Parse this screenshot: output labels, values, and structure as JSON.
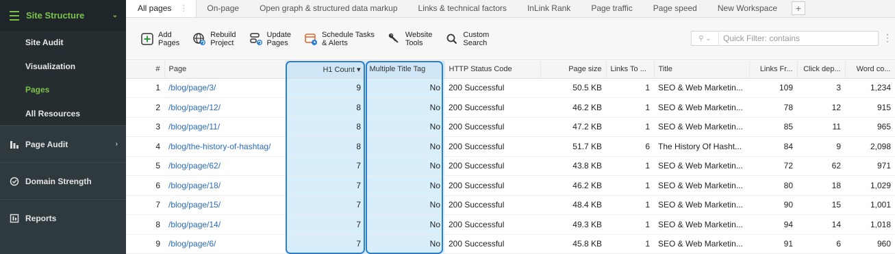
{
  "sidebar": {
    "section_title": "Site Structure",
    "sub_items": [
      {
        "label": "Site Audit",
        "active": false
      },
      {
        "label": "Visualization",
        "active": false
      },
      {
        "label": "Pages",
        "active": true
      },
      {
        "label": "All Resources",
        "active": false
      }
    ],
    "main_items": [
      {
        "label": "Page Audit",
        "icon": "page-audit-icon"
      },
      {
        "label": "Domain Strength",
        "icon": "domain-strength-icon"
      },
      {
        "label": "Reports",
        "icon": "reports-icon"
      }
    ]
  },
  "tabs": [
    "All pages",
    "On-page",
    "Open graph & structured data markup",
    "Links & technical factors",
    "InLink Rank",
    "Page traffic",
    "Page speed",
    "New Workspace"
  ],
  "toolbar": {
    "add_l1": "Add",
    "add_l2": "Pages",
    "rebuild_l1": "Rebuild",
    "rebuild_l2": "Project",
    "update_l1": "Update",
    "update_l2": "Pages",
    "schedule_l1": "Schedule Tasks",
    "schedule_l2": "& Alerts",
    "website_l1": "Website",
    "website_l2": "Tools",
    "custom_l1": "Custom",
    "custom_l2": "Search"
  },
  "filter": {
    "placeholder": "Quick Filter: contains"
  },
  "table": {
    "headers": [
      "#",
      "Page",
      "H1 Count ▾",
      "Multiple Title Tag",
      "HTTP Status Code",
      "Page size",
      "Links To ...",
      "Title",
      "Links Fr...",
      "Click dep...",
      "Word co..."
    ],
    "rows": [
      [
        "1",
        "/blog/page/3/",
        "9",
        "No",
        "200 Successful",
        "50.5 KB",
        "1",
        "SEO & Web Marketin...",
        "109",
        "3",
        "1,234"
      ],
      [
        "2",
        "/blog/page/12/",
        "8",
        "No",
        "200 Successful",
        "46.2 KB",
        "1",
        "SEO & Web Marketin...",
        "78",
        "12",
        "915"
      ],
      [
        "3",
        "/blog/page/11/",
        "8",
        "No",
        "200 Successful",
        "47.2 KB",
        "1",
        "SEO & Web Marketin...",
        "85",
        "11",
        "965"
      ],
      [
        "4",
        "/blog/the-history-of-hashtag/",
        "8",
        "No",
        "200 Successful",
        "51.7 KB",
        "6",
        "The History Of Hasht...",
        "84",
        "9",
        "2,098"
      ],
      [
        "5",
        "/blog/page/62/",
        "7",
        "No",
        "200 Successful",
        "43.8 KB",
        "1",
        "SEO & Web Marketin...",
        "72",
        "62",
        "971"
      ],
      [
        "6",
        "/blog/page/18/",
        "7",
        "No",
        "200 Successful",
        "46.2 KB",
        "1",
        "SEO & Web Marketin...",
        "80",
        "18",
        "1,029"
      ],
      [
        "7",
        "/blog/page/15/",
        "7",
        "No",
        "200 Successful",
        "48.4 KB",
        "1",
        "SEO & Web Marketin...",
        "90",
        "15",
        "1,001"
      ],
      [
        "8",
        "/blog/page/14/",
        "7",
        "No",
        "200 Successful",
        "49.3 KB",
        "1",
        "SEO & Web Marketin...",
        "94",
        "14",
        "1,018"
      ],
      [
        "9",
        "/blog/page/6/",
        "7",
        "No",
        "200 Successful",
        "45.8 KB",
        "1",
        "SEO & Web Marketin...",
        "91",
        "6",
        "960"
      ]
    ]
  },
  "colors": {
    "accent": "#7cc24a",
    "highlight": "#2a7fd0",
    "link": "#2a6bb8"
  }
}
